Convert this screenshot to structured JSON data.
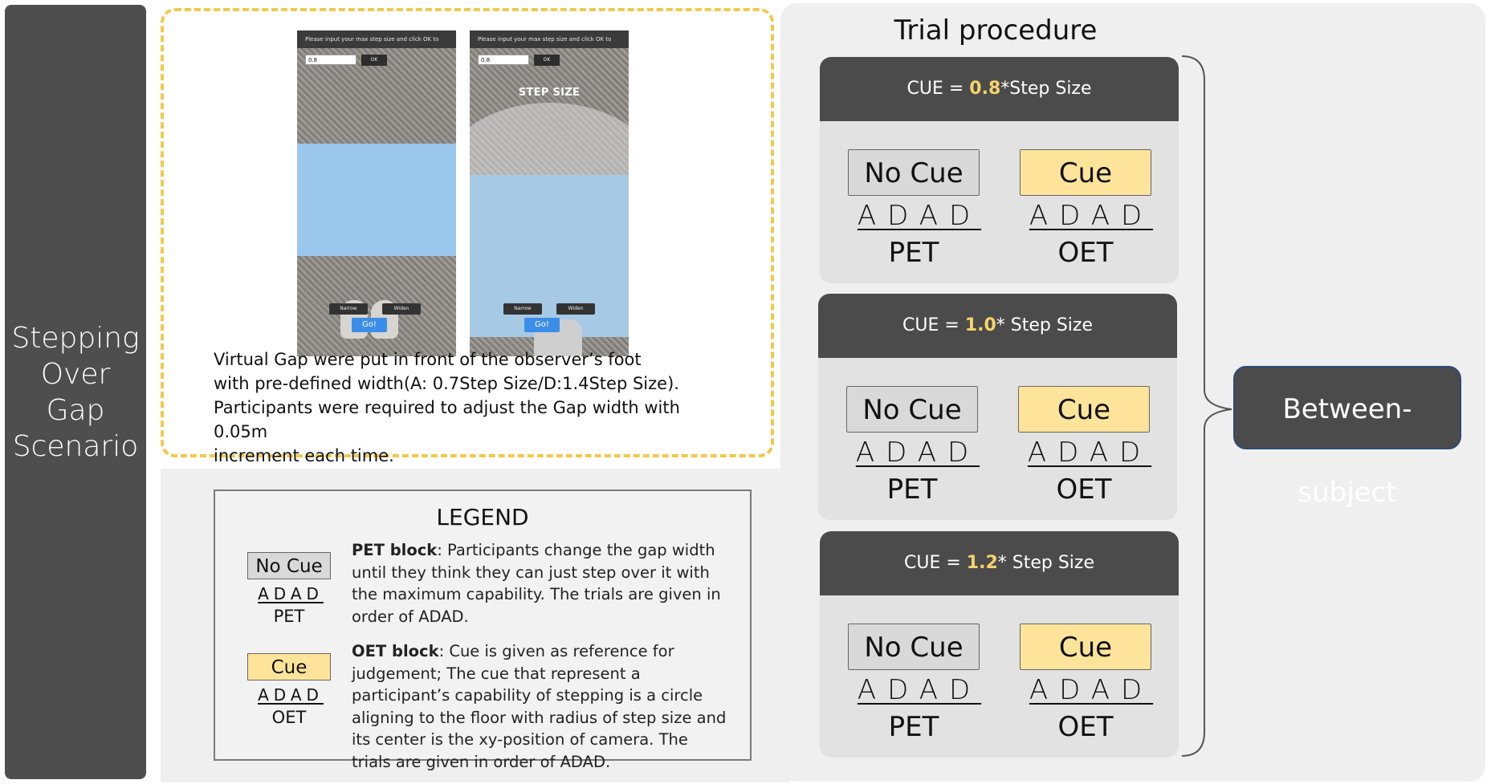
{
  "side_title": {
    "line1": "Stepping",
    "line2": "Over",
    "line3": "Gap",
    "line4": "Scenario"
  },
  "phones": {
    "left": {
      "prompt": "Please input your max step size and click OK to confirm:",
      "input_value": "0.8",
      "ok_label": "OK",
      "narrow_label": "Narrow",
      "widen_label": "Widen",
      "go_label": "Go!"
    },
    "right": {
      "prompt": "Please input your max step size and click OK to confirm:",
      "input_value": "0.8",
      "ok_label": "OK",
      "overlay_label": "STEP SIZE",
      "narrow_label": "Narrow",
      "widen_label": "Widen",
      "go_label": "Go!"
    }
  },
  "demo_description": {
    "line1": "Virtual Gap were put in front of the observer’s foot",
    "line2": "with pre-defined width(A: 0.7Step Size/D:1.4Step Size).",
    "line3": "Participants were required to adjust the Gap width with 0.05m",
    "line4": "increment each time."
  },
  "legend": {
    "title": "LEGEND",
    "pet": {
      "chip": "No Cue",
      "sequence": "ADAD",
      "name": "PET",
      "block_label": "PET block",
      "text": ": Participants change the gap width until they think they can just step over it with the maximum capability. The trials are given in order of ADAD."
    },
    "oet": {
      "chip": "Cue",
      "sequence": "ADAD",
      "name": "OET",
      "block_label": "OET block",
      "text": ": Cue is given as reference for judgement; The cue that represent a participant’s capability of stepping is a circle aligning to the floor with radius of step size and its center is the xy-position of camera. The trials are given in order of ADAD."
    }
  },
  "trial": {
    "title": "Trial procedure",
    "conditions": [
      {
        "prefix": "CUE = ",
        "value": "0.8",
        "suffix": "*Step Size",
        "no_cue": "No Cue",
        "cue": "Cue",
        "seq": "ADAD",
        "pet": "PET",
        "oet": "OET"
      },
      {
        "prefix": "CUE = ",
        "value": "1.0",
        "suffix": "* Step Size",
        "no_cue": "No Cue",
        "cue": "Cue",
        "seq": "ADAD",
        "pet": "PET",
        "oet": "OET"
      },
      {
        "prefix": "CUE = ",
        "value": "1.2",
        "suffix": "* Step Size",
        "no_cue": "No Cue",
        "cue": "Cue",
        "seq": "ADAD",
        "pet": "PET",
        "oet": "OET"
      }
    ],
    "between_label": "Between-subject"
  },
  "colors": {
    "dark_panel": "#4b4b4b",
    "highlight_yellow": "#f5d36b",
    "cue_fill": "#fde49a",
    "no_cue_fill": "#d9d9d9",
    "dashed_border": "#f2c94c",
    "gap_blue": "#9cc7ec"
  }
}
